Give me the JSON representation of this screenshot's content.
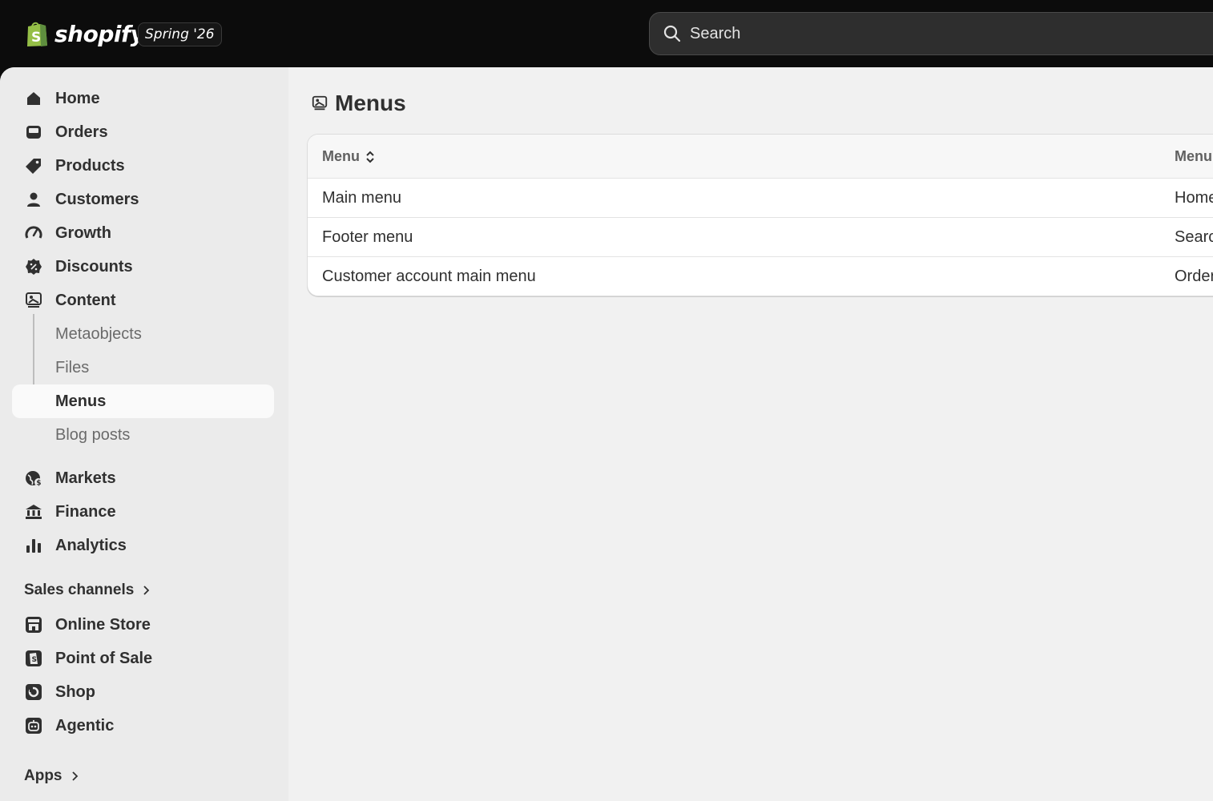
{
  "header": {
    "brand": "shopify",
    "edition": "Spring '26",
    "search_placeholder": "Search"
  },
  "sidebar": {
    "items": [
      {
        "label": "Home",
        "icon": "home-icon"
      },
      {
        "label": "Orders",
        "icon": "inbox-icon"
      },
      {
        "label": "Products",
        "icon": "tag-icon"
      },
      {
        "label": "Customers",
        "icon": "person-icon"
      },
      {
        "label": "Growth",
        "icon": "gauge-icon"
      },
      {
        "label": "Discounts",
        "icon": "discount-badge-icon"
      },
      {
        "label": "Content",
        "icon": "content-image-icon"
      }
    ],
    "content_children": [
      {
        "label": "Metaobjects"
      },
      {
        "label": "Files"
      },
      {
        "label": "Menus",
        "active": true
      },
      {
        "label": "Blog posts"
      }
    ],
    "items2": [
      {
        "label": "Markets",
        "icon": "globe-icon"
      },
      {
        "label": "Finance",
        "icon": "bank-icon"
      },
      {
        "label": "Analytics",
        "icon": "bar-chart-icon"
      }
    ],
    "sales_channels_label": "Sales channels",
    "channels": [
      {
        "label": "Online Store",
        "icon": "storefront-icon"
      },
      {
        "label": "Point of Sale",
        "icon": "pos-icon"
      },
      {
        "label": "Shop",
        "icon": "shop-app-icon"
      },
      {
        "label": "Agentic",
        "icon": "agentic-icon"
      }
    ],
    "apps_label": "Apps"
  },
  "main": {
    "title": "Menus",
    "table": {
      "columns": [
        "Menu",
        "Menu"
      ],
      "rows": [
        [
          "Main menu",
          "Home"
        ],
        [
          "Footer menu",
          "Search"
        ],
        [
          "Customer account main menu",
          "Orders"
        ]
      ]
    }
  }
}
